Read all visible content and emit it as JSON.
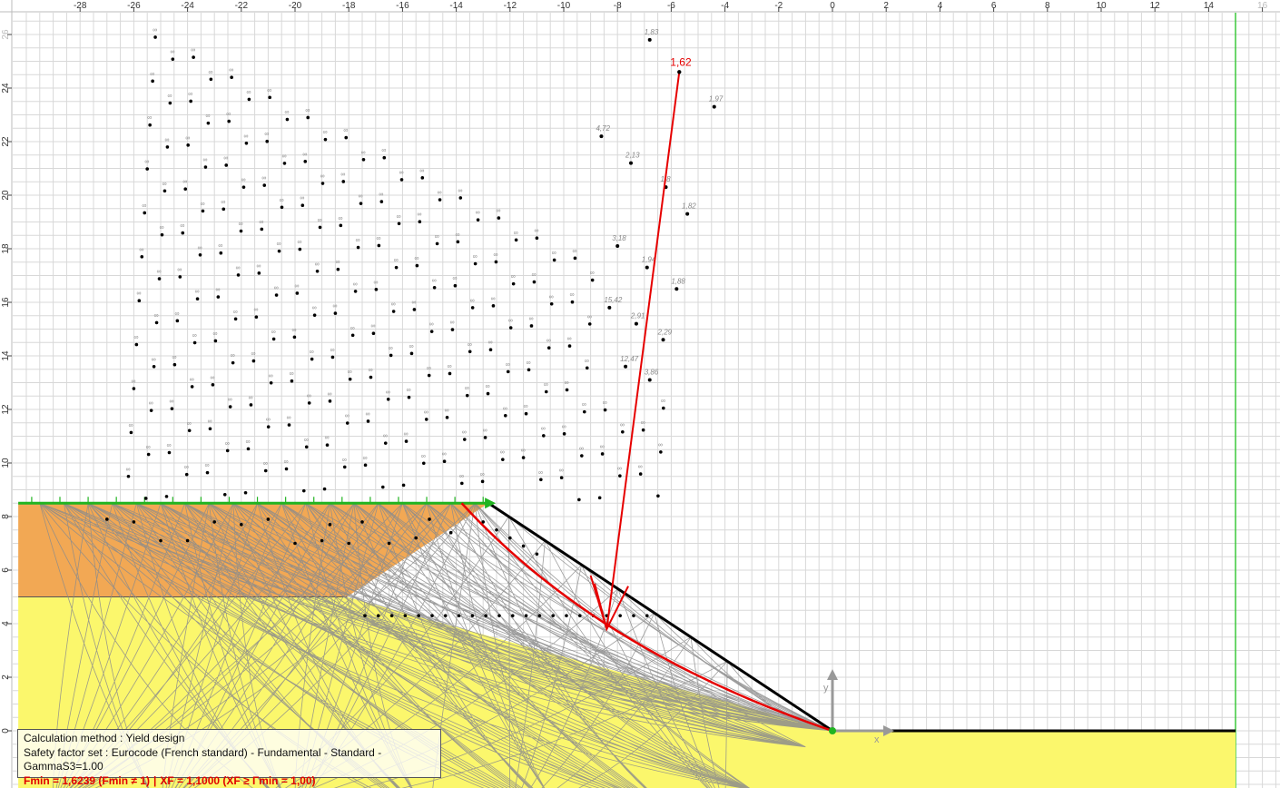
{
  "axes": {
    "x_ticks": [
      -28,
      -26,
      -24,
      -22,
      -20,
      -18,
      -16,
      -14,
      -12,
      -10,
      -8,
      -6,
      -4,
      -2,
      0,
      2,
      4,
      6,
      8,
      10,
      12,
      14,
      16
    ],
    "y_ticks": [
      0,
      2,
      4,
      6,
      8,
      10,
      12,
      14,
      16,
      18,
      20,
      22,
      24,
      26
    ],
    "x_axis_label": "x",
    "y_axis_label": "y"
  },
  "colors": {
    "upper_layer": "#f2a854",
    "lower_layer": "#fbf76c",
    "foundation": "#fbf74a",
    "grid": "#d8d8d8",
    "critical_surface": "#e60000",
    "loaded_surface": "#21b421",
    "failure_lines": "#8c8c8c"
  },
  "critical": {
    "factor_label": "1,62",
    "center": [
      -5.7,
      24.6
    ],
    "start": [
      -13.8,
      8.5
    ],
    "end": [
      0,
      0
    ]
  },
  "center_labels": [
    {
      "text": "1,83",
      "x": -6.8,
      "y": 25.8
    },
    {
      "text": "1,97",
      "x": -4.4,
      "y": 23.3
    },
    {
      "text": "4,72",
      "x": -8.6,
      "y": 22.2
    },
    {
      "text": "2,13",
      "x": -7.5,
      "y": 21.2
    },
    {
      "text": "1,8",
      "x": -6.2,
      "y": 20.3
    },
    {
      "text": "1,82",
      "x": -5.4,
      "y": 19.3
    },
    {
      "text": "3,18",
      "x": -8.0,
      "y": 18.1
    },
    {
      "text": "1,94",
      "x": -6.9,
      "y": 17.3
    },
    {
      "text": "1,88",
      "x": -5.8,
      "y": 16.5
    },
    {
      "text": "15,42",
      "x": -8.3,
      "y": 15.8
    },
    {
      "text": "2,91",
      "x": -7.3,
      "y": 15.2
    },
    {
      "text": "2,29",
      "x": -6.3,
      "y": 14.6
    },
    {
      "text": "12,47",
      "x": -7.7,
      "y": 13.6
    },
    {
      "text": "3,86",
      "x": -6.8,
      "y": 13.1
    }
  ],
  "infinite_label": "∞",
  "info": {
    "method": "Calculation method : Yield design",
    "safety_set": "Safety factor set : Eurocode (French standard) - Fundamental - Standard - GammaS3=1.00",
    "fmin": "Fmin = 1,6239 (Fmin ≠ 1)",
    "separator": "|",
    "xf": "XF = 1,1000 (XF ≥ Γmin = 1,00)"
  }
}
